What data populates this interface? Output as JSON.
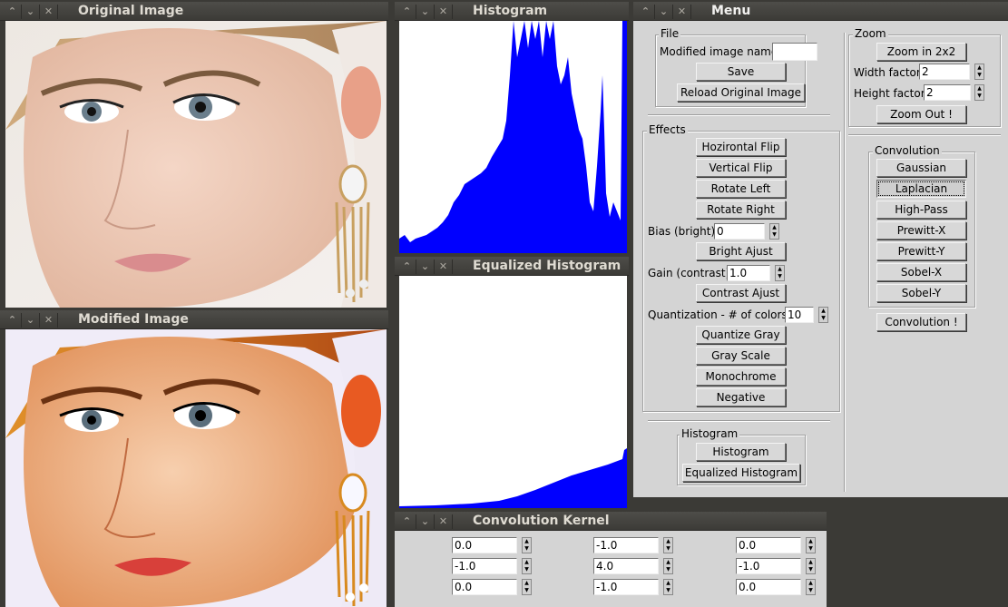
{
  "windows": {
    "original": {
      "title": "Original Image"
    },
    "modified": {
      "title": "Modified Image"
    },
    "histogram": {
      "title": "Histogram"
    },
    "equalized": {
      "title": "Equalized Histogram"
    },
    "menu": {
      "title": "Menu"
    },
    "kernel": {
      "title": "Convolution Kernel"
    }
  },
  "window_controls": {
    "minimize": "⌃",
    "maximize": "⌄",
    "close": "✕"
  },
  "colors": {
    "histogram_bars": "#0000ff",
    "titlebar": "#3c3b37",
    "panel": "#d4d4d4"
  },
  "menu": {
    "file": {
      "group_title": "File",
      "name_label": "Modified image name:",
      "name_value": "",
      "save_label": "Save",
      "reload_label": "Reload Original Image"
    },
    "effects": {
      "group_title": "Effects",
      "hflip_label": "Hozirontal Flip",
      "vflip_label": "Vertical Flip",
      "rotl_label": "Rotate Left",
      "rotr_label": "Rotate Right",
      "bias_label": "Bias (bright):",
      "bias_value": "0",
      "bright_label": "Bright Ajust",
      "gain_label": "Gain (contrast):",
      "gain_value": "1.0",
      "contrast_label": "Contrast Ajust",
      "quant_label": "Quantization - # of colors:",
      "quant_value": "10",
      "quantize_label": "Quantize Gray",
      "gray_label": "Gray Scale",
      "mono_label": "Monochrome",
      "neg_label": "Negative"
    },
    "histogram": {
      "group_title": "Histogram",
      "hist_label": "Histogram",
      "eq_label": "Equalized Histogram"
    },
    "zoom": {
      "group_title": "Zoom",
      "zoomin_label": "Zoom in 2x2",
      "width_label": "Width factor:",
      "width_value": "2",
      "height_label": "Height factor:",
      "height_value": "2",
      "zoomout_label": "Zoom Out !"
    },
    "convolution": {
      "group_title": "Convolution",
      "gaussian": "Gaussian",
      "laplacian": "Laplacian",
      "highpass": "High-Pass",
      "prewittx": "Prewitt-X",
      "prewitty": "Prewitt-Y",
      "sobelx": "Sobel-X",
      "sobely": "Sobel-Y",
      "apply": "Convolution !"
    }
  },
  "kernel": {
    "rows": [
      [
        "0.0",
        "-1.0",
        "0.0"
      ],
      [
        "-1.0",
        "4.0",
        "-1.0"
      ],
      [
        "0.0",
        "-1.0",
        "0.0"
      ]
    ]
  }
}
